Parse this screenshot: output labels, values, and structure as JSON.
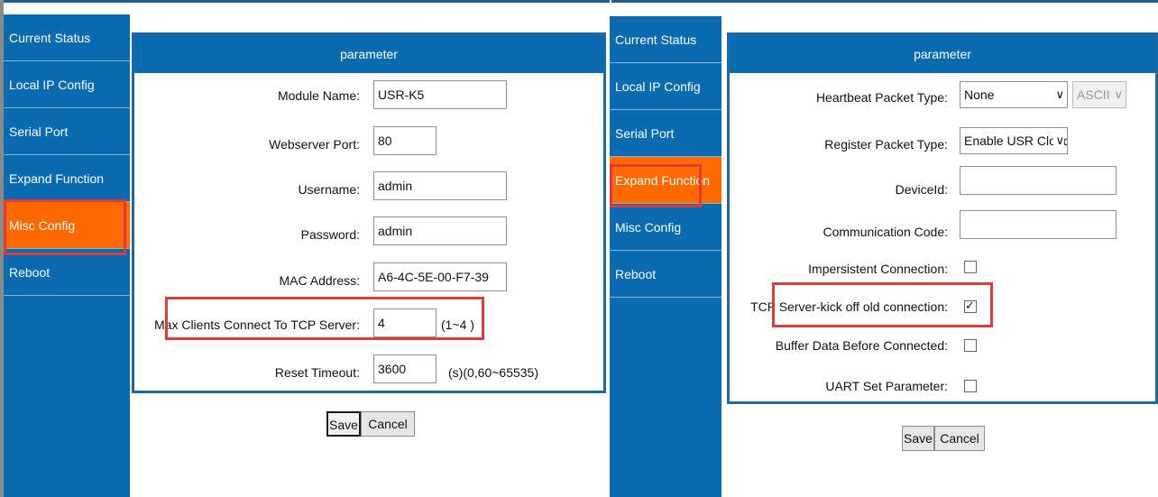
{
  "left": {
    "nav": [
      "Current Status",
      "Local IP Config",
      "Serial Port",
      "Expand Function",
      "Misc Config",
      "Reboot"
    ],
    "header": "parameter",
    "fields": {
      "module_name": {
        "label": "Module Name:",
        "value": "USR-K5"
      },
      "webserver_port": {
        "label": "Webserver Port:",
        "value": "80"
      },
      "username": {
        "label": "Username:",
        "value": "admin"
      },
      "password": {
        "label": "Password:",
        "value": "admin"
      },
      "mac_address": {
        "label": "MAC Address:",
        "value": "A6-4C-5E-00-F7-39"
      },
      "max_clients": {
        "label": "Max Clients Connect To TCP Server:",
        "value": "4",
        "suffix": "(1~4 )"
      },
      "reset_timeout": {
        "label": "Reset Timeout:",
        "value": "3600",
        "suffix": "(s)(0,60~65535)"
      }
    },
    "save_label": "Save",
    "cancel_label": "Cancel"
  },
  "right": {
    "nav": [
      "Current Status",
      "Local IP Config",
      "Serial Port",
      "Expand Function",
      "Misc Config",
      "Reboot"
    ],
    "header": "parameter",
    "fields": {
      "heartbeat": {
        "label": "Heartbeat Packet Type:",
        "value": "None",
        "second_value": "ASCII"
      },
      "register": {
        "label": "Register Packet Type:",
        "value": "Enable USR Cloud"
      },
      "device_id": {
        "label": "DeviceId:",
        "value": ""
      },
      "comm_code": {
        "label": "Communication Code:",
        "value": ""
      },
      "impersistent": {
        "label": "Impersistent Connection:",
        "checked": false
      },
      "kick_off": {
        "label": "TCP Server-kick off old connection:",
        "checked": true
      },
      "buffer_data": {
        "label": "Buffer Data Before Connected:",
        "checked": false
      },
      "uart_param": {
        "label": "UART Set Parameter:",
        "checked": false
      }
    },
    "save_label": "Save",
    "cancel_label": "Cancel"
  }
}
